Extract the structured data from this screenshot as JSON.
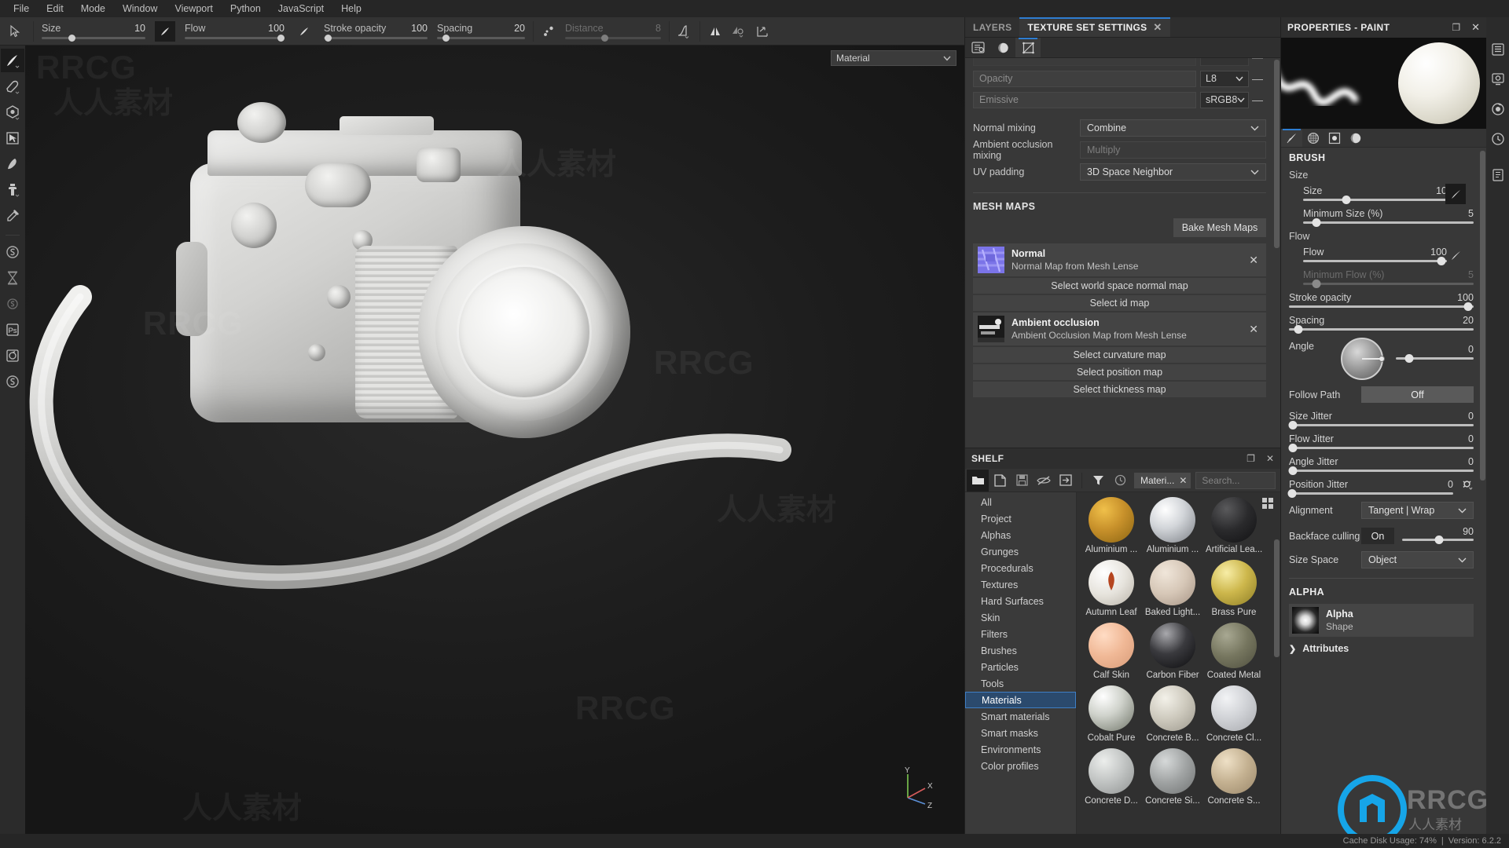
{
  "menu": {
    "items": [
      "File",
      "Edit",
      "Mode",
      "Window",
      "Viewport",
      "Python",
      "JavaScript",
      "Help"
    ]
  },
  "toolbar": {
    "params": [
      {
        "label": "Size",
        "value": "10",
        "fill": 0.28,
        "dim": false
      },
      {
        "label": "Flow",
        "value": "100",
        "fill": 0.96,
        "dim": false
      },
      {
        "label": "Stroke opacity",
        "value": "100",
        "fill": 0.04,
        "dim": false
      },
      {
        "label": "Spacing",
        "value": "20",
        "fill": 0.07,
        "dim": false
      },
      {
        "label": "Distance",
        "value": "8",
        "fill": 0.4,
        "dim": true
      }
    ],
    "icons": [
      "brush-preset-icon",
      "symmetry-icon",
      "symmetry-settings-icon",
      "tiling-icon"
    ],
    "right_icons": [
      "pause-icon",
      "perspective-icon",
      "cube-icon",
      "camera-icon",
      "screenshot-icon"
    ]
  },
  "left_rail": {
    "tools": [
      {
        "name": "paint-brush-tool",
        "active": true
      },
      {
        "name": "eraser-tool",
        "active": false
      },
      {
        "name": "projection-tool",
        "active": false
      },
      {
        "name": "polygon-fill-tool",
        "active": false
      },
      {
        "name": "smudge-tool",
        "active": false
      },
      {
        "name": "clone-tool",
        "active": false
      },
      {
        "name": "color-picker-tool",
        "active": false
      },
      {
        "name": "substance-material-tool",
        "active": false
      },
      {
        "name": "hourglass-tool",
        "active": false
      },
      {
        "name": "substance-effect-tool",
        "active": false
      },
      {
        "name": "photoshop-link-tool",
        "active": false
      },
      {
        "name": "render-iray-tool",
        "active": false
      },
      {
        "name": "substance-bottom-tool",
        "active": false
      }
    ]
  },
  "viewport": {
    "material_select": "Material",
    "axis_labels": {
      "x": "X",
      "y": "Y",
      "z": "Z"
    }
  },
  "texture_set": {
    "tabs": [
      {
        "label": "LAYERS",
        "active": false
      },
      {
        "label": "TEXTURE SET SETTINGS",
        "active": true
      }
    ],
    "close_glyph": "✕",
    "subtabs": [
      "texture-set-settings-icon",
      "shader-settings-icon",
      "uv-settings-icon"
    ],
    "channels": [
      {
        "label": "Opacity",
        "format": "L8"
      },
      {
        "label": "Emissive",
        "format": "sRGB8"
      }
    ],
    "dropdowns": [
      {
        "label": "Normal mixing",
        "value": "Combine",
        "muted": false
      },
      {
        "label": "Ambient occlusion mixing",
        "value": "Multiply",
        "muted": true
      },
      {
        "label": "UV padding",
        "value": "3D Space Neighbor",
        "muted": false
      }
    ],
    "mesh_maps_title": "MESH MAPS",
    "bake_button": "Bake Mesh Maps",
    "maps": [
      {
        "title": "Normal",
        "subtitle": "Normal Map from Mesh Lense",
        "thumb": "normal-map-thumb"
      },
      {
        "title": "Ambient occlusion",
        "subtitle": "Ambient Occlusion Map from Mesh Lense",
        "thumb": "ao-map-thumb"
      }
    ],
    "map_buttons_a": [
      "Select world space normal map",
      "Select id map"
    ],
    "map_buttons_b": [
      "Select curvature map",
      "Select position map",
      "Select thickness map"
    ]
  },
  "shelf": {
    "title": "SHELF",
    "window_glyphs": {
      "restore": "❐",
      "close": "✕"
    },
    "toolbar_icons": [
      "folder-icon",
      "new-file-icon",
      "save-icon",
      "hide-icon",
      "import-icon",
      "filter-icon",
      "clock-icon"
    ],
    "filter_chip": "Materi...",
    "filter_chip_close": "✕",
    "search_placeholder": "Search...",
    "categories": [
      {
        "label": "All",
        "selected": false
      },
      {
        "label": "Project",
        "selected": false
      },
      {
        "label": "Alphas",
        "selected": false
      },
      {
        "label": "Grunges",
        "selected": false
      },
      {
        "label": "Procedurals",
        "selected": false
      },
      {
        "label": "Textures",
        "selected": false
      },
      {
        "label": "Hard Surfaces",
        "selected": false
      },
      {
        "label": "Skin",
        "selected": false
      },
      {
        "label": "Filters",
        "selected": false
      },
      {
        "label": "Brushes",
        "selected": false
      },
      {
        "label": "Particles",
        "selected": false
      },
      {
        "label": "Tools",
        "selected": false
      },
      {
        "label": "Materials",
        "selected": true
      },
      {
        "label": "Smart materials",
        "selected": false
      },
      {
        "label": "Smart masks",
        "selected": false
      },
      {
        "label": "Environments",
        "selected": false
      },
      {
        "label": "Color profiles",
        "selected": false
      }
    ],
    "materials": [
      {
        "label": "Aluminium ...",
        "color1": "#f0c04a",
        "color2": "#8a6412",
        "dots": true
      },
      {
        "label": "Aluminium ...",
        "color1": "#e9eaec",
        "color2": "#7b7f85",
        "dots": false
      },
      {
        "label": "Artificial Lea...",
        "color1": "#3a3a3c",
        "color2": "#111113",
        "dots": false
      },
      {
        "label": "Autumn Leaf",
        "color1": "#f2f0ec",
        "color2": "#b9b3a8",
        "dots": true
      },
      {
        "label": "Baked Light...",
        "color1": "#ded1c4",
        "color2": "#a59384",
        "dots": false
      },
      {
        "label": "Brass Pure",
        "color1": "#e9d884",
        "color2": "#8c7c25",
        "dots": false
      },
      {
        "label": "Calf Skin",
        "color1": "#f3c4a6",
        "color2": "#d79b78",
        "dots": false
      },
      {
        "label": "Carbon Fiber",
        "color1": "#6d6d70",
        "color2": "#0c0c0e",
        "dots": true
      },
      {
        "label": "Coated Metal",
        "color1": "#8d8d78",
        "color2": "#4e4e3e",
        "dots": true
      },
      {
        "label": "Cobalt Pure",
        "color1": "#e6e8e4",
        "color2": "#6f7468",
        "dots": false
      },
      {
        "label": "Concrete B...",
        "color1": "#e0ded6",
        "color2": "#9b978c",
        "dots": true
      },
      {
        "label": "Concrete Cl...",
        "color1": "#e5e6e8",
        "color2": "#a7a9ad",
        "dots": true
      },
      {
        "label": "Concrete D...",
        "color1": "#d6d8d6",
        "color2": "#8f9291",
        "dots": true
      },
      {
        "label": "Concrete Si...",
        "color1": "#bdc0c0",
        "color2": "#6f7272",
        "dots": true
      },
      {
        "label": "Concrete S...",
        "color1": "#d9c8ad",
        "color2": "#9a876a",
        "dots": true
      }
    ]
  },
  "properties": {
    "title": "PROPERTIES - PAINT",
    "window_glyphs": {
      "float": "❐",
      "close": "✕"
    },
    "preview_tabs": [
      "brush-preview-tab",
      "grid-preview-tab",
      "alpha-preview-tab",
      "material-preview-tab"
    ],
    "brush_section": "BRUSH",
    "size_group": "Size",
    "flow_group": "Flow",
    "controls": [
      {
        "name": "size",
        "label": "Size",
        "value": "10",
        "fill": 0.3,
        "dim": false,
        "indent": true,
        "chip": true
      },
      {
        "name": "minimum-size",
        "label": "Minimum Size (%)",
        "value": "5",
        "fill": 0.08,
        "dim": false,
        "indent": true,
        "chip": false
      },
      {
        "name": "flow",
        "label": "Flow",
        "value": "100",
        "fill": 0.96,
        "dim": false,
        "indent": true,
        "chip": true
      },
      {
        "name": "minimum-flow",
        "label": "Minimum Flow (%)",
        "value": "5",
        "fill": 0.08,
        "dim": true,
        "indent": true,
        "chip": false
      },
      {
        "name": "stroke-opacity",
        "label": "Stroke opacity",
        "value": "100",
        "fill": 0.97,
        "dim": false,
        "indent": false,
        "chip": false
      },
      {
        "name": "spacing",
        "label": "Spacing",
        "value": "20",
        "fill": 0.05,
        "dim": false,
        "indent": false,
        "chip": false
      }
    ],
    "angle": {
      "label": "Angle",
      "value": "0",
      "fill": 0.17
    },
    "follow_path": {
      "label": "Follow Path",
      "value": "Off"
    },
    "jitters": [
      {
        "label": "Size Jitter",
        "value": "0",
        "fill": 0.02
      },
      {
        "label": "Flow Jitter",
        "value": "0",
        "fill": 0.02
      },
      {
        "label": "Angle Jitter",
        "value": "0",
        "fill": 0.02
      },
      {
        "label": "Position Jitter",
        "value": "0",
        "fill": 0.02
      }
    ],
    "alignment": {
      "label": "Alignment",
      "value": "Tangent | Wrap"
    },
    "backface": {
      "label": "Backface culling",
      "toggle": "On",
      "value": "90",
      "fill": 0.52
    },
    "size_space": {
      "label": "Size Space",
      "value": "Object"
    },
    "alpha_section": "ALPHA",
    "alpha_card": {
      "title": "Alpha",
      "subtitle": "Shape"
    },
    "attributes": {
      "label": "Attributes",
      "chevron": "❯"
    }
  },
  "far_rail": {
    "icons": [
      "list-icon",
      "gear-display-icon",
      "iray-render-icon",
      "history-icon",
      "log-icon"
    ]
  },
  "status": {
    "cache": "Cache Disk Usage:  74%",
    "separator": "|",
    "version": "Version: 6.2.2"
  },
  "watermarks": {
    "brand": "RRCG",
    "cn": "人人素材"
  }
}
